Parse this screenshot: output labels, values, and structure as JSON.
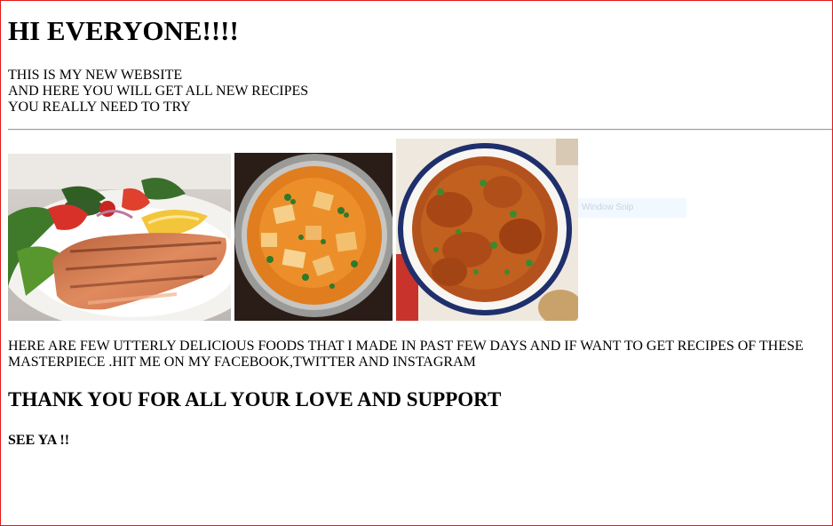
{
  "heading": "HI EVERYONE!!!!",
  "intro": {
    "line1": "THIS IS MY NEW WEBSITE",
    "line2": "AND HERE YOU WILL GET ALL NEW RECIPES",
    "line3": "YOU REALLY NEED TO TRY"
  },
  "description": "HERE ARE FEW UTTERLY DELICIOUS FOODS THAT I MADE IN PAST FEW DAYS AND IF WANT TO GET RECIPES OF THESE MASTERPIECE .HIT ME ON MY FACEBOOK,TWITTER AND INSTAGRAM",
  "thanks": "THANK YOU FOR ALL YOUR LOVE AND SUPPORT",
  "signoff": "SEE YA !!",
  "overlay_text": "Window Snip",
  "colors": {
    "page_border": "#e01919",
    "rule": "#9a9a9a"
  }
}
